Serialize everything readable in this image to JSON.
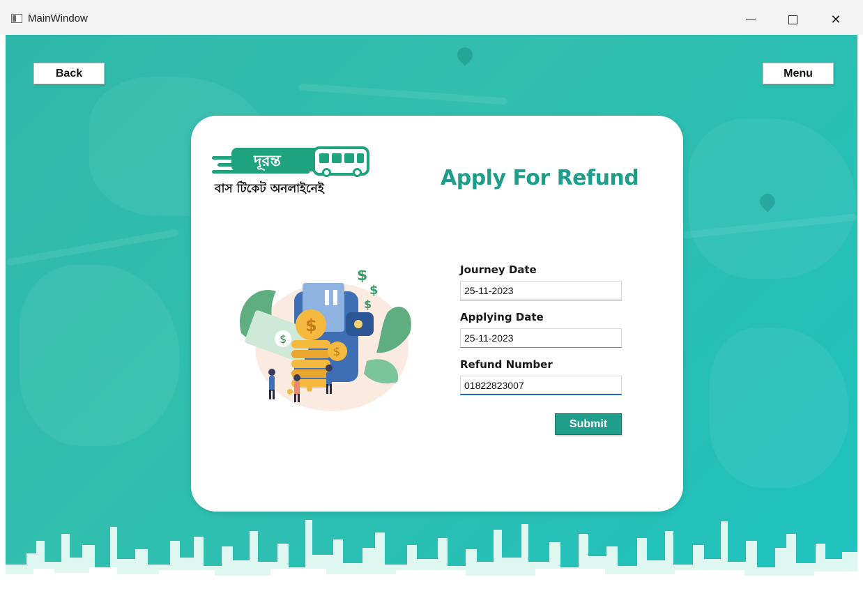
{
  "window": {
    "title": "MainWindow",
    "controls": {
      "minimize": "—",
      "maximize": "☐",
      "close": "✕"
    }
  },
  "nav": {
    "back_label": "Back",
    "menu_label": "Menu"
  },
  "logo": {
    "brand_bn": "দূরন্ত",
    "tagline_bn": "বাস টিকেট অনলাইনেই"
  },
  "form": {
    "title": "Apply For Refund",
    "journey_date": {
      "label": "Journey Date",
      "value": "25-11-2023"
    },
    "applying_date": {
      "label": "Applying Date",
      "value": "25-11-2023"
    },
    "refund_number": {
      "label": "Refund Number",
      "value": "01822823007"
    },
    "submit_label": "Submit"
  },
  "colors": {
    "accent": "#1f9e8c",
    "background": "#2fb8a9",
    "focus": "#1b66c9"
  },
  "icons": [
    "app-window-icon",
    "minimize-icon",
    "maximize-icon",
    "close-icon",
    "bus-icon",
    "refund-wallet-illustration"
  ]
}
